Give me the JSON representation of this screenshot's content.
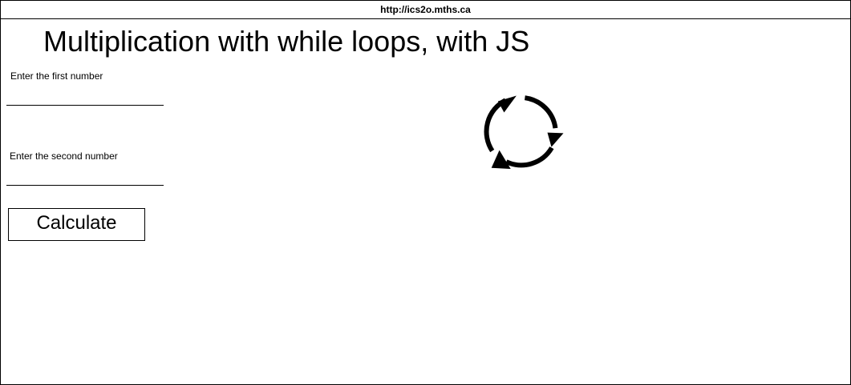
{
  "browser": {
    "url": "http://ics2o.mths.ca"
  },
  "page": {
    "title": "Multiplication with while loops, with JS"
  },
  "form": {
    "first_label": "Enter the first number",
    "first_value": "",
    "second_label": "Enter the second number",
    "second_value": "",
    "calculate_label": "Calculate"
  },
  "icons": {
    "cycle": "cycle-arrows-icon"
  }
}
